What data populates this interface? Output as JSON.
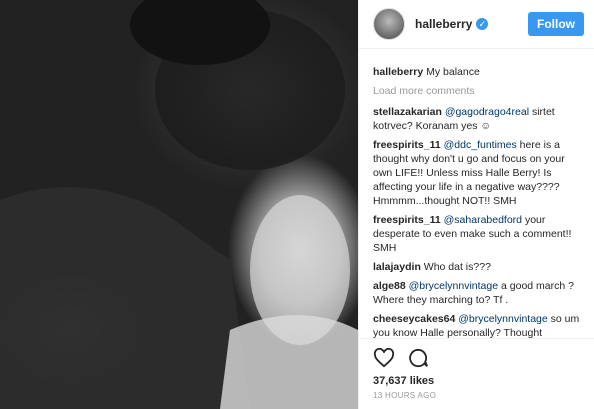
{
  "post": {
    "username": "halleberry",
    "follow_label": "Follow",
    "caption_user": "halleberry",
    "caption_text": "My balance",
    "load_more": "Load more comments",
    "likes": "37,637 likes",
    "timestamp": "13 HOURS AGO",
    "accent_color": "#3897f0"
  },
  "comments": [
    {
      "user": "stellazakarian",
      "mention": "@gagodrago4real",
      "text": " sirtet kotrvec? Koranam yes ☺"
    },
    {
      "user": "freespirits_11",
      "mention": "@ddc_funtimes",
      "text": " here is a thought why don't u go and focus on your own LIFE!! Unless miss Halle Berry! Is affecting your life in a negative way???? Hmmmm...thought NOT!! SMH"
    },
    {
      "user": "freespirits_11",
      "mention": "@saharabedford",
      "text": " your desperate to even make such a comment!! SMH"
    },
    {
      "user": "lalajaydin",
      "mention": "",
      "text": "Who dat is???"
    },
    {
      "user": "alge88",
      "mention": "@brycelynnvintage",
      "text": " a good march ? Where they marching to? Tf ."
    },
    {
      "user": "cheeseycakes64",
      "mention": "@brycelynnvintage",
      "text": " so um you know Halle personally? Thought Not.....HAPPINESS IS ALWAYS A MATCH!!!"
    }
  ],
  "icons": {
    "like": "heart-icon",
    "comment": "comment-icon",
    "verified": "verified-badge-icon"
  }
}
